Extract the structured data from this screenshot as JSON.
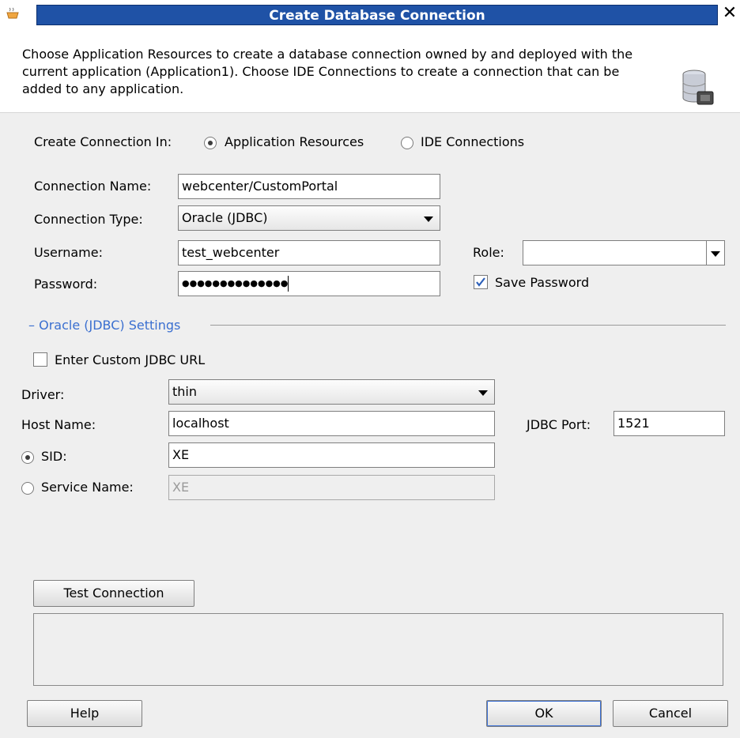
{
  "window": {
    "title": "Create Database Connection",
    "close_glyph": "✕"
  },
  "header": {
    "description": "Choose Application Resources to create a database connection owned by and deployed with the current application (Application1). Choose IDE Connections to create a connection that can be added to any application.",
    "icon": "database-connection-icon"
  },
  "create_in": {
    "label": "Create Connection In:",
    "options": [
      "Application Resources",
      "IDE Connections"
    ],
    "selected": "Application Resources"
  },
  "form": {
    "connection_name_label": "Connection Name:",
    "connection_name_value": "webcenter/CustomPortal",
    "connection_type_label": "Connection Type:",
    "connection_type_value": "Oracle (JDBC)",
    "username_label": "Username:",
    "username_value": "test_webcenter",
    "password_label": "Password:",
    "password_masked": "●●●●●●●●●●●●●●",
    "role_label": "Role:",
    "role_value": "",
    "save_password_label": "Save Password",
    "save_password_checked": true
  },
  "settings": {
    "section_title": "Oracle (JDBC) Settings",
    "custom_url_label": "Enter Custom JDBC URL",
    "custom_url_checked": false,
    "driver_label": "Driver:",
    "driver_value": "thin",
    "host_label": "Host Name:",
    "host_value": "localhost",
    "port_label": "JDBC Port:",
    "port_value": "1521",
    "sid_label": "SID:",
    "sid_value": "XE",
    "service_label": "Service Name:",
    "service_value": "XE",
    "selected_identifier": "SID"
  },
  "test": {
    "button_label": "Test Connection",
    "status_text": ""
  },
  "footer": {
    "help_label": "Help",
    "ok_label": "OK",
    "cancel_label": "Cancel"
  },
  "colors": {
    "title_bar": "#1f52a6",
    "section_title": "#3a6fd0",
    "focus_ring": "#3b6fd4"
  }
}
